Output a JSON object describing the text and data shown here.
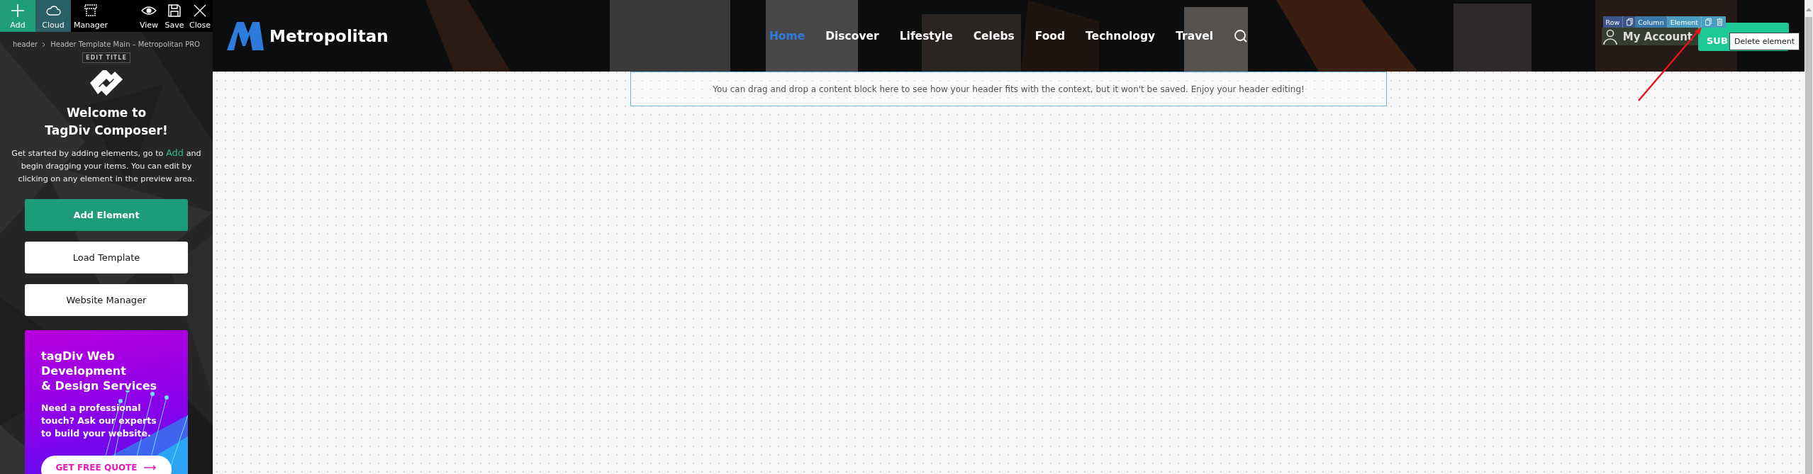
{
  "composer_toolbar": [
    {
      "label": "Add",
      "kind": "accent",
      "selected": false
    },
    {
      "label": "Cloud",
      "kind": "plain",
      "selected": true
    },
    {
      "label": "Manager",
      "kind": "plain",
      "selected": false
    },
    {
      "label": "View",
      "kind": "plain",
      "selected": false
    },
    {
      "label": "Save",
      "kind": "plain",
      "selected": false
    },
    {
      "label": "Close",
      "kind": "plain",
      "selected": false
    }
  ],
  "breadcrumb": [
    "header",
    "Header Template Main – Metropolitan PRO"
  ],
  "edit_title_button": "EDIT TITLE",
  "welcome_title": "Welcome to\nTagDiv Composer!",
  "intro": {
    "before": "Get started by adding elements, go to",
    "link": "Add",
    "after": "and begin dragging your items. You can edit by clicking on any element in the preview area."
  },
  "buttons": [
    {
      "label": "Add Element",
      "kind": "primary"
    },
    {
      "label": "Load Template",
      "kind": "secondary"
    },
    {
      "label": "Website Manager",
      "kind": "secondary"
    }
  ],
  "promo": {
    "title": "tagDiv Web\nDevelopment\n& Design Services",
    "text": "Need a professional\ntouch? Ask our experts\nto build your website.",
    "button": "GET FREE QUOTE"
  },
  "site_header": {
    "logo": "Metropolitan",
    "nav": [
      {
        "label": "Home",
        "selected": true
      },
      {
        "label": "Discover",
        "selected": false
      },
      {
        "label": "Lifestyle",
        "selected": false
      },
      {
        "label": "Celebs",
        "selected": false
      },
      {
        "label": "Food",
        "selected": false
      },
      {
        "label": "Technology",
        "selected": false
      },
      {
        "label": "Travel",
        "selected": false
      }
    ],
    "account": "My Account",
    "subscribe": "SUB"
  },
  "edit_bar": [
    {
      "label": "Row",
      "color": "#3d5488"
    },
    {
      "label": "Column",
      "color": "#3b78aa"
    },
    {
      "label": "Element",
      "color": "#4a9cc0"
    }
  ],
  "tooltip": "Delete element",
  "drop_hint": "You can drag and drop a content block here to see how your header fits with the context, but it won't be saved. Enjoy your header editing!"
}
